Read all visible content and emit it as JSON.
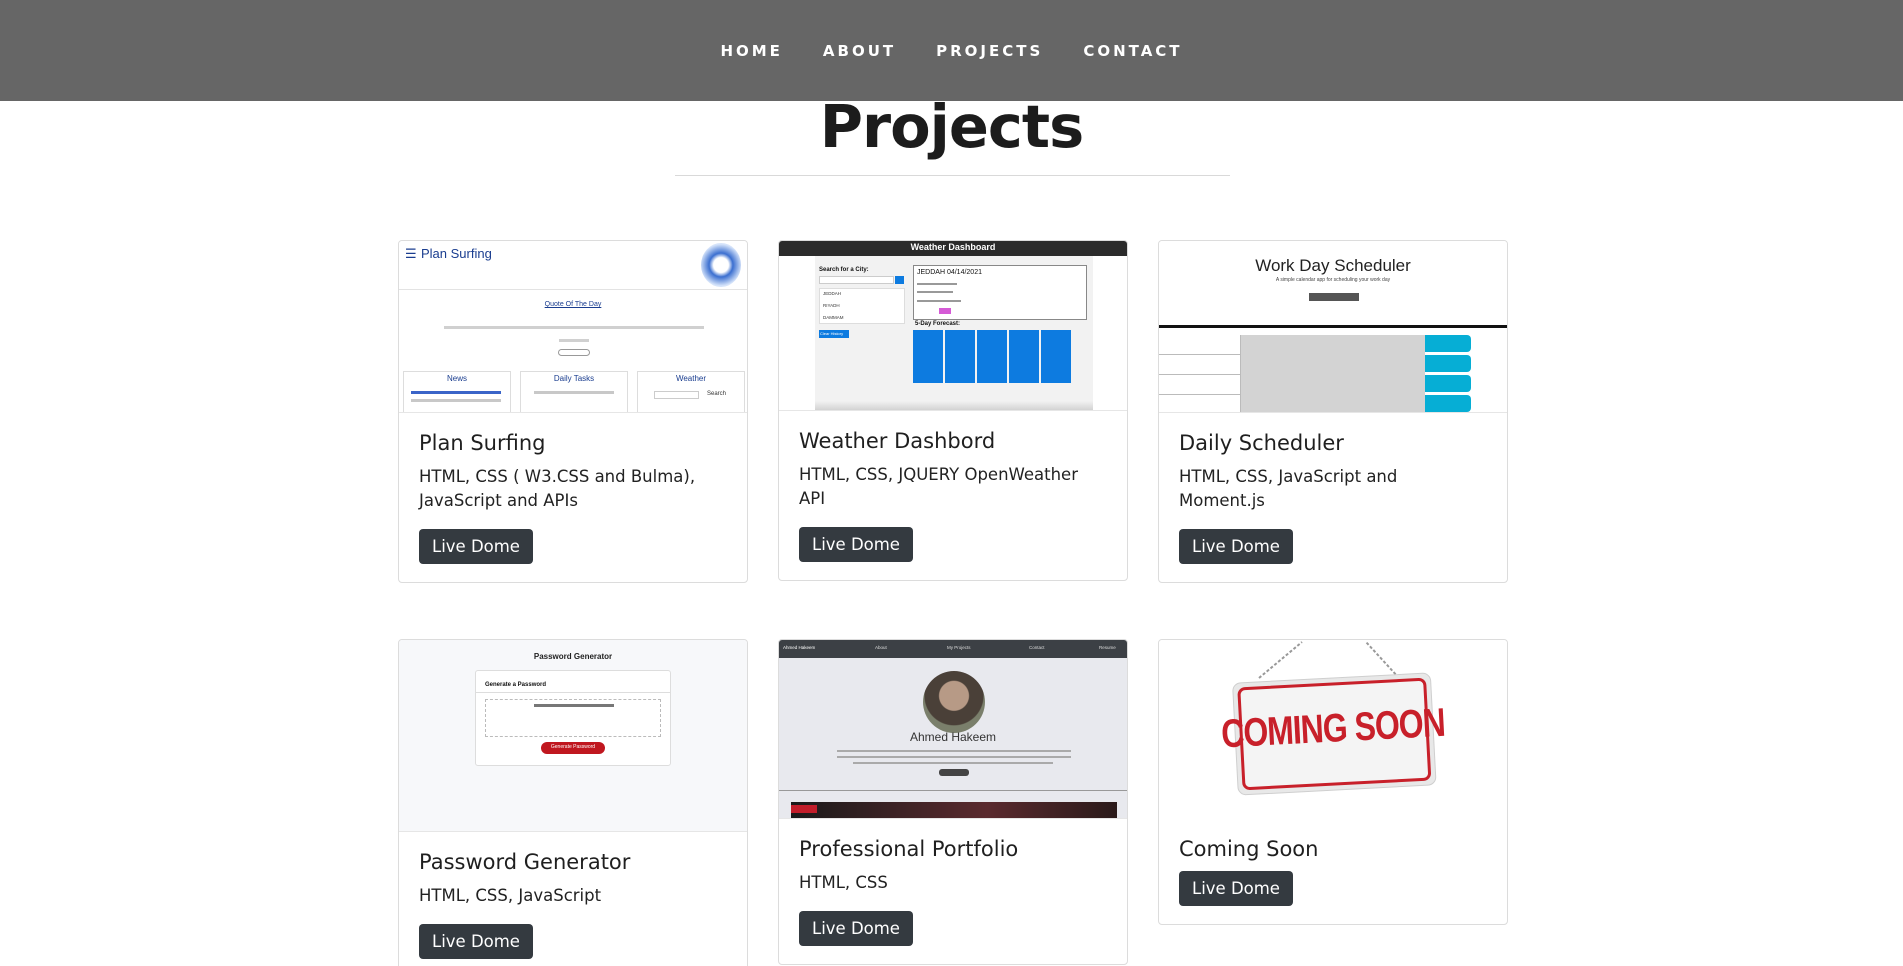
{
  "nav": {
    "items": [
      {
        "label": "HOME"
      },
      {
        "label": "ABOUT"
      },
      {
        "label": "PROJECTS"
      },
      {
        "label": "CONTACT"
      }
    ]
  },
  "page": {
    "title": "Projects"
  },
  "projects": [
    {
      "title": "Plan Surfing",
      "tech": "HTML, CSS ( W3.CSS and Bulma), JavaScript and APIs",
      "button": "Live Dome",
      "thumb": {
        "header": "Plan Surfing",
        "quote_link": "Quote Of The Day",
        "sections": [
          "News",
          "Daily Tasks",
          "Weather"
        ],
        "search_label": "Search"
      }
    },
    {
      "title": "Weather Dashbord",
      "tech": "HTML, CSS, JQUERY OpenWeather API",
      "button": "Live Dome",
      "thumb": {
        "header": "Weather Dashboard",
        "search_label": "Search for a City:",
        "city_title": "JEDDAH 04/14/2021",
        "forecast_label": "5-Day Forecast:",
        "cities": [
          "JEDDAH",
          "RIYADH",
          "DAMMAM"
        ],
        "history_btn": "Clear History"
      }
    },
    {
      "title": "Daily Scheduler",
      "tech": "HTML, CSS, JavaScript and Moment.js",
      "button": "Live Dome",
      "thumb": {
        "header": "Work Day Scheduler",
        "subheader": "A simple calendar app for scheduling your work day"
      }
    },
    {
      "title": "Password Generator",
      "tech": "HTML, CSS, JavaScript",
      "button": "Live Dome",
      "thumb": {
        "header": "Password Generator",
        "card_title": "Generate a Password",
        "generate_btn": "Generate Password"
      }
    },
    {
      "title": "Professional Portfolio",
      "tech": "HTML, CSS",
      "button": "Live Dome",
      "thumb": {
        "name": "Ahmed Hakeem",
        "nav": [
          "Ahmed Hakeem",
          "About",
          "My Projects",
          "Contact",
          "Resume"
        ]
      }
    },
    {
      "title": "Coming Soon",
      "tech": "",
      "button": "Live Dome",
      "thumb": {
        "sign": "COMING SOON"
      }
    }
  ],
  "colors": {
    "navbar": "#666666",
    "button": "#343a40",
    "accent_blue": "#0d7be0",
    "sign_red": "#c8202a"
  }
}
